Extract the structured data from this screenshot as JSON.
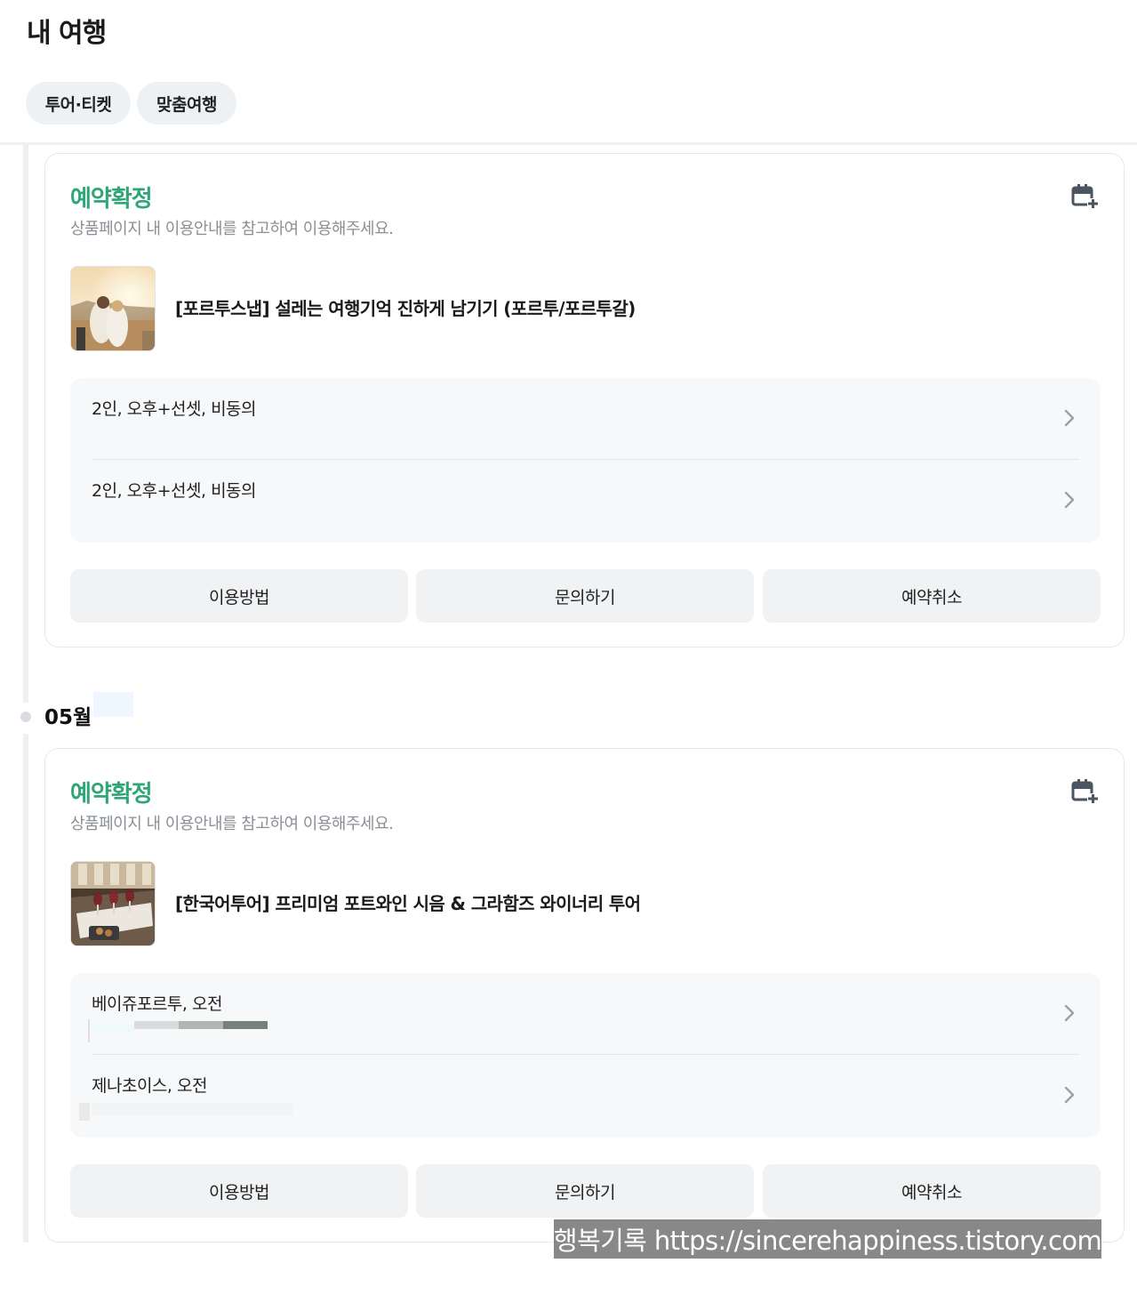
{
  "page": {
    "title": "내 여행"
  },
  "filters": [
    {
      "label": "투어·티켓"
    },
    {
      "label": "맞춤여행"
    }
  ],
  "months": [
    {
      "label": "05월"
    }
  ],
  "bookings": [
    {
      "status": "예약확정",
      "status_desc": "상품페이지 내 이용안내를 참고하여 이용해주세요.",
      "title": "[포르투스냅] 설레는 여행기억 진하게 남기기 (포르투/포르투갈)",
      "options": [
        {
          "label": "2인, 오후+선셋, 비동의"
        },
        {
          "label": "2인, 오후+선셋, 비동의"
        }
      ],
      "actions": {
        "guide": "이용방법",
        "inquiry": "문의하기",
        "cancel": "예약취소"
      }
    },
    {
      "status": "예약확정",
      "status_desc": "상품페이지 내 이용안내를 참고하여 이용해주세요.",
      "title": "[한국어투어] 프리미엄 포트와인 시음  & 그라함즈 와이너리 투어",
      "options": [
        {
          "label": "베이쥬포르투, 오전"
        },
        {
          "label": "제나초이스, 오전"
        }
      ],
      "actions": {
        "guide": "이용방법",
        "inquiry": "문의하기",
        "cancel": "예약취소"
      }
    }
  ],
  "watermark": "행복기록 https://sincerehappiness.tistory.com",
  "colors": {
    "status_green": "#2fa578",
    "chip_bg": "#eef1f3",
    "button_bg": "#f0f2f4",
    "options_bg": "#f7f8f9"
  },
  "icons": {
    "card_action": "calendar-add-icon",
    "option_row": "chevron-right-icon"
  }
}
